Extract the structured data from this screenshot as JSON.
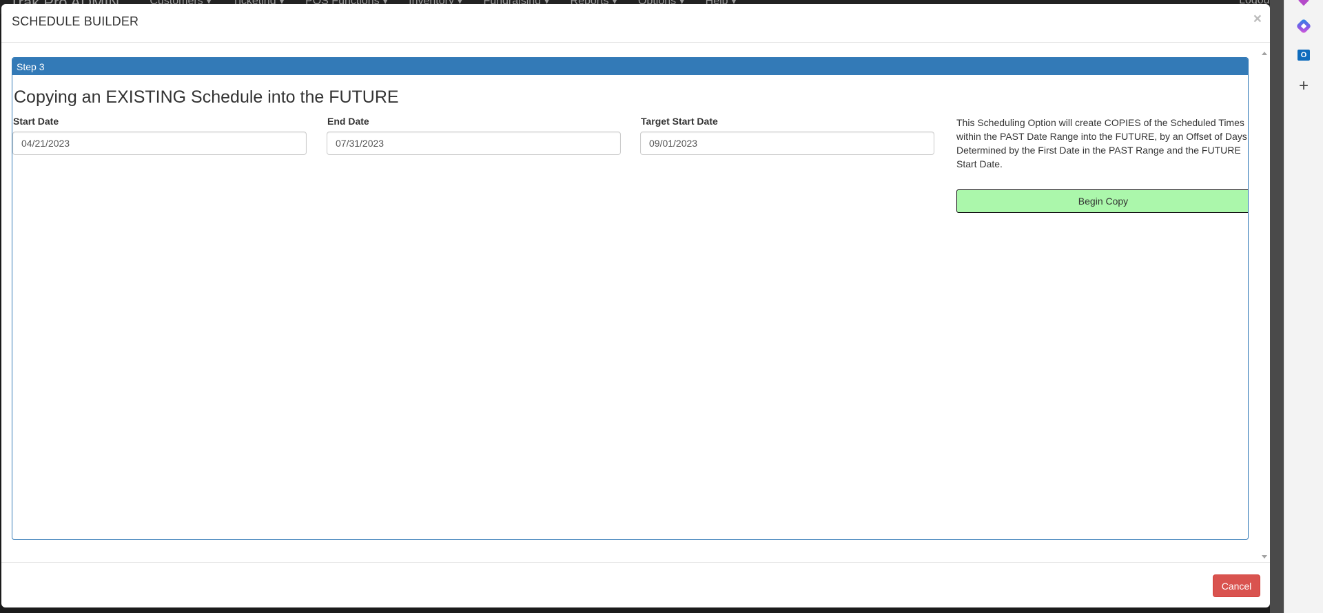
{
  "background_nav": {
    "brand": "Trak Pro ADMIN",
    "items": [
      "Customers ▾",
      "Ticketing ▾",
      "POS Functions ▾",
      "Inventory ▾",
      "Fundraising ▾",
      "Reports ▾",
      "Options ▾",
      "Help ▾"
    ],
    "logout": "Logout"
  },
  "side_panel": {
    "icons": [
      "copilot-icon",
      "outlook-icon",
      "add-icon"
    ],
    "outlook_letter": "O",
    "plus": "+"
  },
  "modal": {
    "title": "SCHEDULE BUILDER",
    "close": "×"
  },
  "panel": {
    "heading": "Step 3",
    "title": "Copying an EXISTING Schedule into the FUTURE"
  },
  "fields": {
    "start_date": {
      "label": "Start Date",
      "value": "04/21/2023"
    },
    "end_date": {
      "label": "End Date",
      "value": "07/31/2023"
    },
    "target_start_date": {
      "label": "Target Start Date",
      "value": "09/01/2023"
    }
  },
  "info": {
    "text": "This Scheduling Option will create COPIES of the Scheduled Times within the PAST Date Range into the FUTURE, by an Offset of Days Determined by the First Date in the PAST Range and the FUTURE Start Date."
  },
  "buttons": {
    "begin_copy": "Begin Copy",
    "cancel": "Cancel"
  },
  "colors": {
    "panel_primary": "#337ab7",
    "begin_copy_bg": "#abf7ab",
    "cancel_bg": "#d9534f"
  }
}
